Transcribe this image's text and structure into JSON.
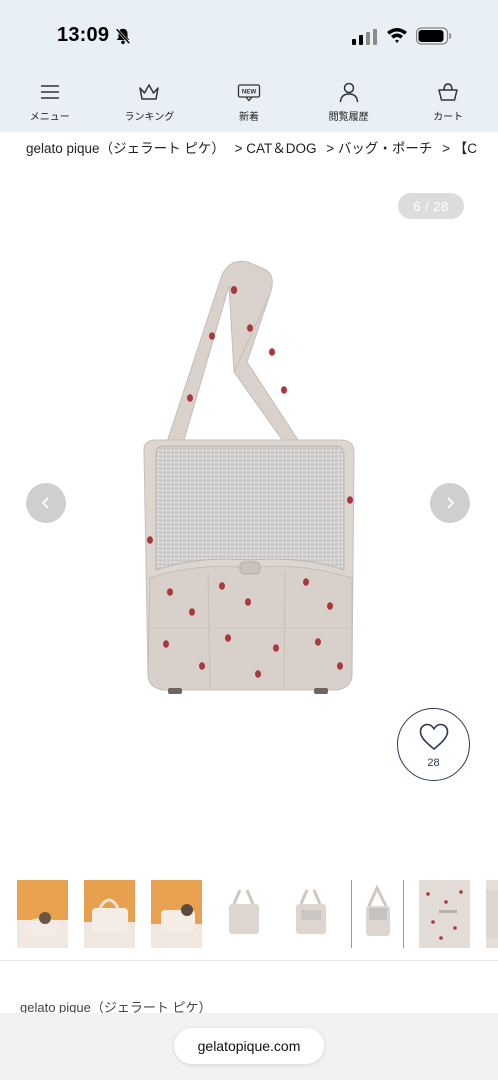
{
  "status_bar": {
    "time": "13:09",
    "icons": [
      "bell-slash-icon",
      "cellular-signal-icon",
      "wifi-icon",
      "battery-icon"
    ]
  },
  "nav": {
    "items": [
      {
        "label": "メニュー",
        "icon": "menu-icon"
      },
      {
        "label": "ランキング",
        "icon": "crown-icon"
      },
      {
        "label": "新着",
        "icon": "new-badge-icon",
        "badge_text": "NEW"
      },
      {
        "label": "閲覧履歴",
        "icon": "person-icon"
      },
      {
        "label": "カート",
        "icon": "cart-basket-icon"
      }
    ]
  },
  "breadcrumb": {
    "items": [
      "gelato pique（ジェラート ピケ）",
      "> CAT＆DOG",
      "> バッグ・ポーチ",
      "> 【C"
    ]
  },
  "gallery": {
    "counter": "6 / 28",
    "prev_icon": "chevron-left-icon",
    "next_icon": "chevron-right-icon"
  },
  "favorite": {
    "icon": "heart-icon",
    "count": "28"
  },
  "thumbnails": {
    "count": 8,
    "active_index": 5
  },
  "product": {
    "brand": "gelato pique（ジェラート ピケ）"
  },
  "browser": {
    "url": "gelatopique.com"
  },
  "colors": {
    "header_bg": "#e8eff5",
    "bag_body": "#ddd6d0",
    "pattern_dot": "#a8383c",
    "accent_navy": "#2b3a55"
  }
}
